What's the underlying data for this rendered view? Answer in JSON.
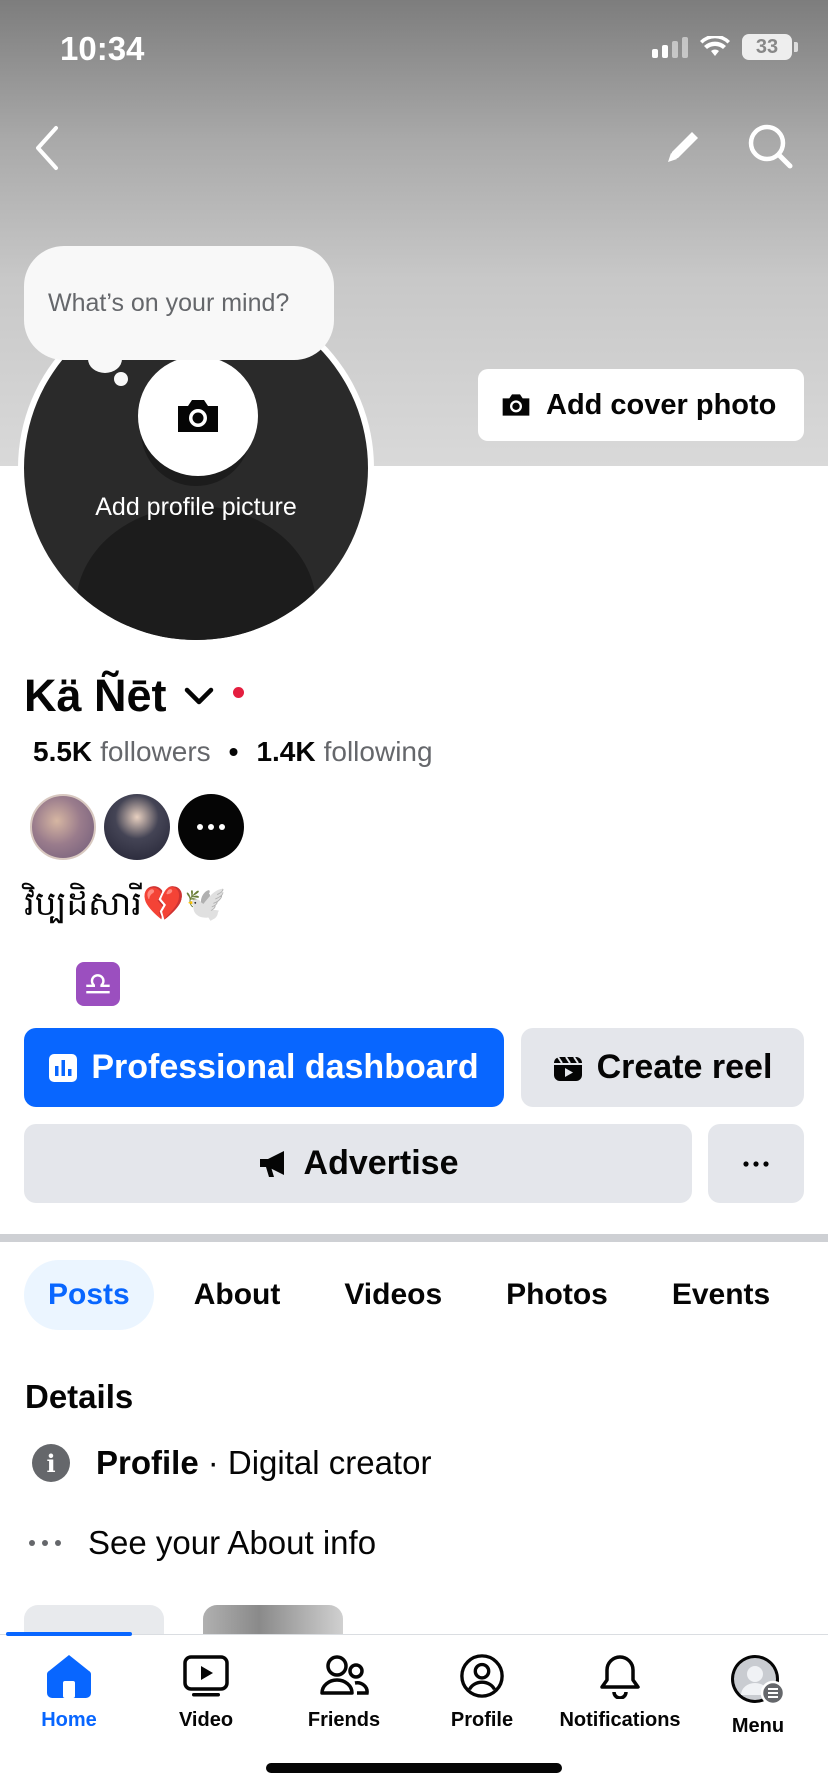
{
  "status_bar": {
    "time": "10:34",
    "battery": "33"
  },
  "profile": {
    "thought_placeholder": "What’s on your mind?",
    "add_profile_picture": "Add profile picture",
    "add_cover_photo": "Add cover photo",
    "name": "Kä Ñēt",
    "followers_count": "5.5K",
    "followers_label": "followers",
    "following_count": "1.4K",
    "following_label": "following",
    "bio": "វិប្បដិសារី💔🕊️",
    "zodiac": "♎"
  },
  "actions": {
    "professional_dashboard": "Professional dashboard",
    "create_reel": "Create reel",
    "advertise": "Advertise",
    "more": "···"
  },
  "tabs": [
    {
      "label": "Posts",
      "active": true
    },
    {
      "label": "About"
    },
    {
      "label": "Videos"
    },
    {
      "label": "Photos"
    },
    {
      "label": "Events"
    }
  ],
  "details": {
    "title": "Details",
    "profile_type_label": "Profile",
    "profile_type_value": "· Digital creator",
    "see_about": "See your About info"
  },
  "nav": [
    {
      "label": "Home",
      "icon": "home-icon",
      "active": true
    },
    {
      "label": "Video",
      "icon": "video-icon"
    },
    {
      "label": "Friends",
      "icon": "friends-icon"
    },
    {
      "label": "Profile",
      "icon": "profile-icon"
    },
    {
      "label": "Notifications",
      "icon": "bell-icon"
    },
    {
      "label": "Menu",
      "icon": "menu-avatar-icon"
    }
  ],
  "colors": {
    "accent": "#0866ff",
    "grey_button": "#e4e6eb",
    "secondary_text": "#65676b",
    "online_dot": "#e41e3f"
  }
}
